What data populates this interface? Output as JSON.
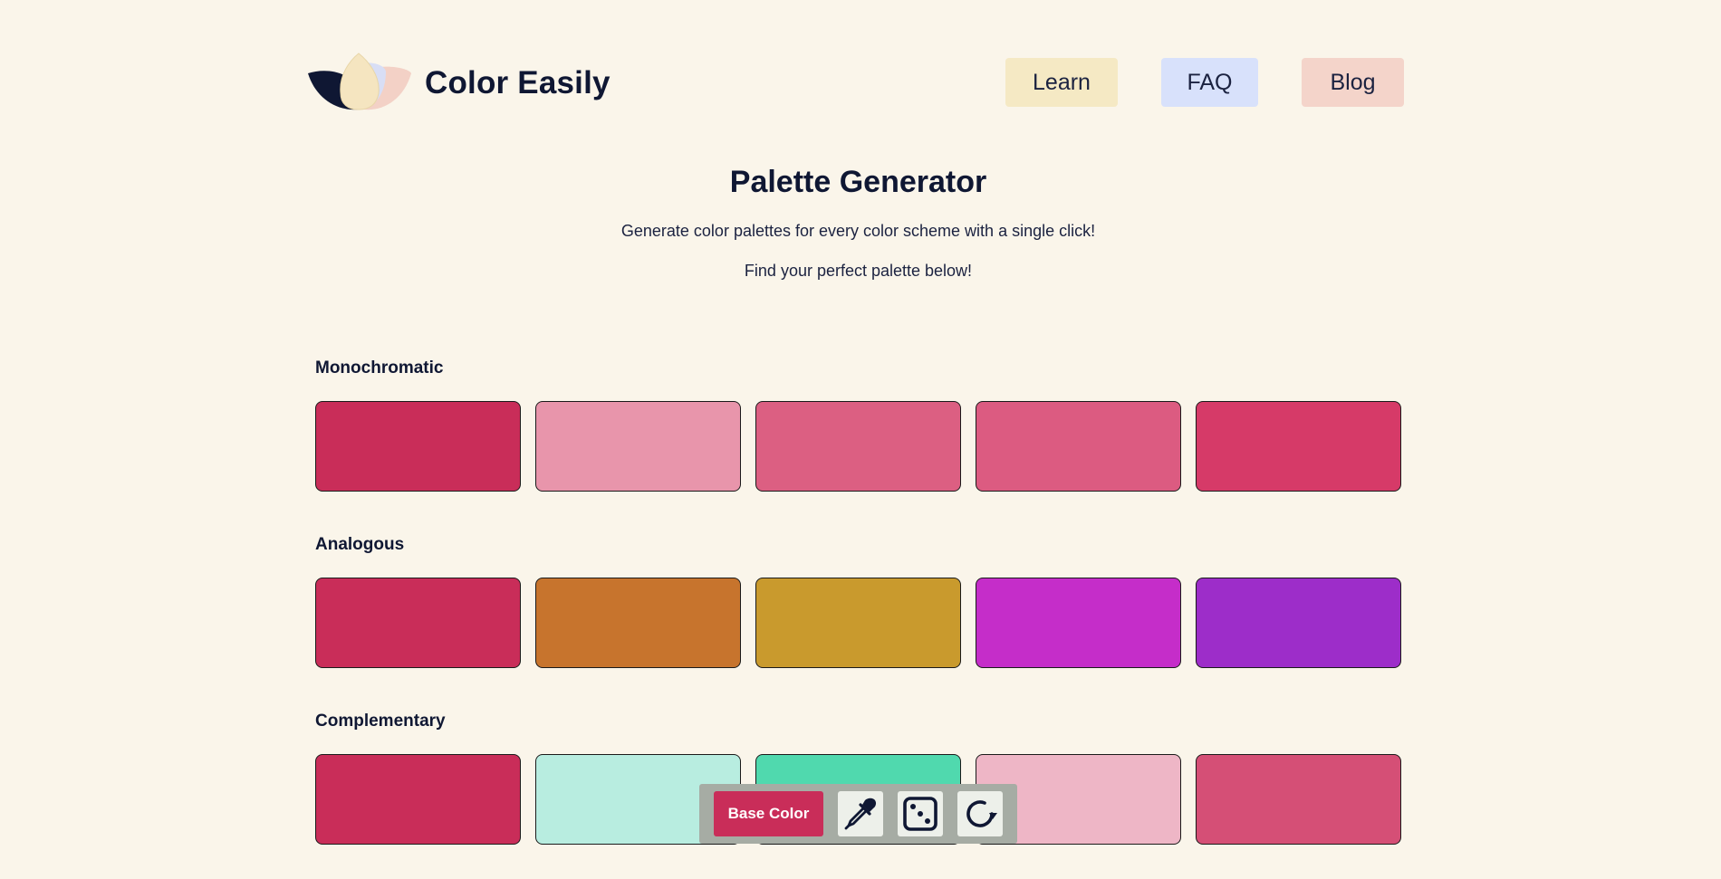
{
  "brand": {
    "name": "Color Easily",
    "logo_colors": [
      "#0f1733",
      "#f5e5c0",
      "#d8def5",
      "#f3d1c6"
    ]
  },
  "nav": [
    {
      "label": "Learn",
      "color": "#f5e9c4"
    },
    {
      "label": "FAQ",
      "color": "#d8e1fb"
    },
    {
      "label": "Blog",
      "color": "#f4d4ca"
    }
  ],
  "hero": {
    "title": "Palette Generator",
    "line1": "Generate color palettes for every color scheme with a single click!",
    "line2": "Find your perfect palette below!"
  },
  "palettes": [
    {
      "name": "Monochromatic",
      "colors": [
        "#c92d59",
        "#e895ab",
        "#dc5f82",
        "#dc5b81",
        "#d63a68"
      ]
    },
    {
      "name": "Analogous",
      "colors": [
        "#c92d59",
        "#c7742d",
        "#c99a2d",
        "#c52dc9",
        "#9d2dc9"
      ]
    },
    {
      "name": "Complementary",
      "colors": [
        "#c92d59",
        "#b8ede0",
        "#50d9ae",
        "#eeb6c6",
        "#d54f76"
      ]
    }
  ],
  "toolbar": {
    "base_color_label": "Base Color",
    "base_color": "#c92d59",
    "tools": [
      "eyedropper-icon",
      "dice-icon",
      "refresh-icon"
    ]
  }
}
